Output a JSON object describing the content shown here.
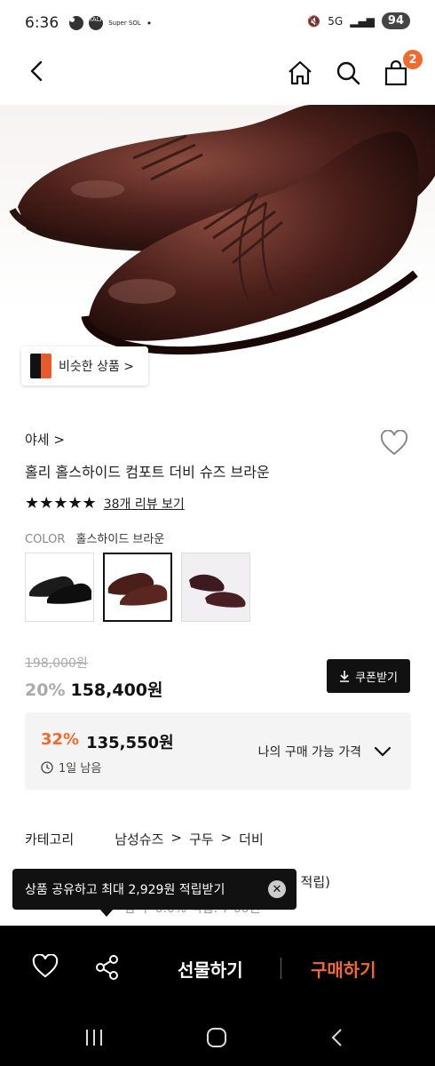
{
  "status_bar": {
    "time": "6:36",
    "noti_labels": [
      "TALK",
      "Super SOL"
    ],
    "network": "5G",
    "battery": "94"
  },
  "nav": {
    "cart_count": "2"
  },
  "similar_button": {
    "label": "비슷한 상품 >"
  },
  "product": {
    "brand": "야세 >",
    "title": "홀리 홀스하이드 컴포트 더비 슈즈 브라운",
    "stars": "★★★★★",
    "review_link": "38개 리뷰 보기",
    "color_label": "COLOR",
    "color_value": "홀스하이드 브라운",
    "original_price": "198,000원",
    "discount_pct": "20%",
    "sale_price": "158,400원",
    "coupon_label": "쿠폰받기"
  },
  "best_price": {
    "pct": "32%",
    "price": "135,550원",
    "timer": "1일 남음",
    "label": "나의 구매 가능 가격"
  },
  "category": {
    "label": "카테고리",
    "path": [
      "남성슈즈",
      ">",
      "구두",
      ">",
      "더비"
    ]
  },
  "partial_text": {
    "line1": "적립)",
    "line2": "함 주 0.0% 적립: 7 00원"
  },
  "toast": {
    "text": "상품 공유하고 최대 2,929원 적립받기",
    "close": "✕"
  },
  "action_bar": {
    "gift_label": "선물하기",
    "buy_label": "구매하기"
  },
  "colors": {
    "accent": "#f06a2d",
    "leather": "#4a1f1a"
  }
}
